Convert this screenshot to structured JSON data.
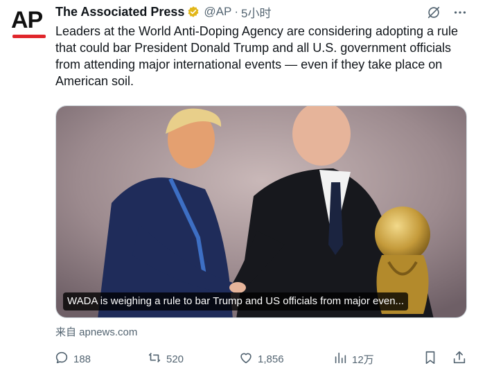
{
  "author": {
    "avatar_text": "AP",
    "display_name": "The Associated Press",
    "handle": "@AP",
    "separator": "·",
    "timestamp": "5小时"
  },
  "tweet": {
    "text": "Leaders at the World Anti-Doping Agency are considering adopting a rule that could bar President Donald Trump and all U.S. government officials from attending major international events — even if they take place on American soil."
  },
  "media": {
    "caption": "WADA is weighing a rule to bar Trump and US officials from major even...",
    "source": "来自 apnews.com"
  },
  "actions": {
    "replies": "188",
    "reposts": "520",
    "likes": "1,856",
    "views": "12万"
  },
  "colors": {
    "text_primary": "#0f1419",
    "text_secondary": "#536471",
    "verified_gold": "#e2b719",
    "ap_red": "#e0262b"
  },
  "icons": {
    "verified": "verified-badge-icon",
    "grok": "grok-icon",
    "more": "more-icon",
    "reply": "reply-icon",
    "repost": "repost-icon",
    "like": "like-icon",
    "views": "views-icon",
    "bookmark": "bookmark-icon",
    "share": "share-icon"
  }
}
